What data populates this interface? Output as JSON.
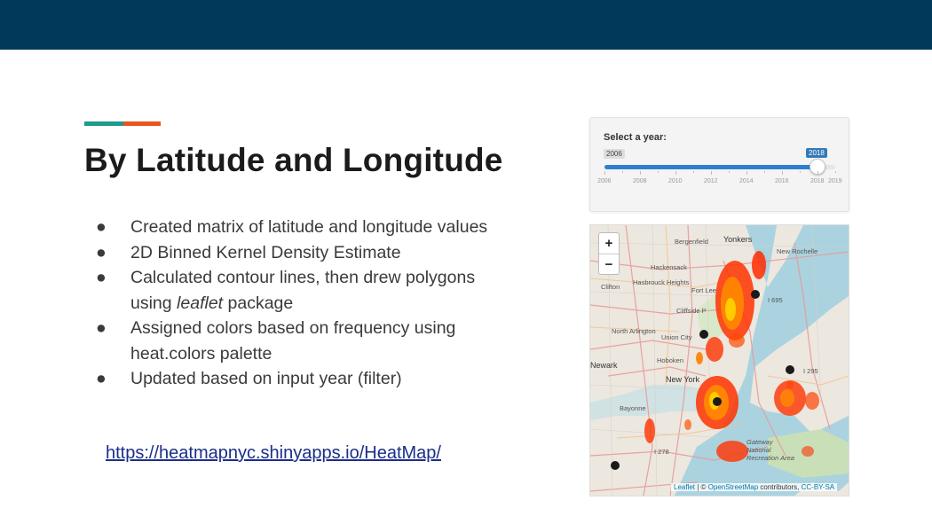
{
  "slide": {
    "title": "By Latitude and Longitude",
    "bullets": [
      {
        "text": "Created matrix of latitude and longitude values"
      },
      {
        "text": "2D Binned Kernel Density Estimate"
      },
      {
        "text_pre": "Calculated contour lines, then drew polygons using ",
        "text_em": "leaflet",
        "text_post": " package"
      },
      {
        "text": "Assigned colors based on frequency using heat.colors palette"
      },
      {
        "text": "Updated based on input year (filter)"
      }
    ],
    "bullet_marker": "●",
    "link": "https://heatmapnyc.shinyapps.io/HeatMap/"
  },
  "slider": {
    "label": "Select a year:",
    "min_label": "2006",
    "value_label": "2018",
    "min": 2006,
    "max": 2019,
    "value": 2018,
    "tick_labels": [
      "2006",
      "2008",
      "2010",
      "2012",
      "2014",
      "2016",
      "2018",
      "2019"
    ]
  },
  "map": {
    "zoom_in": "+",
    "zoom_out": "−",
    "attribution": {
      "leaflet": "Leaflet",
      "sep1": " | © ",
      "osm": "OpenStreetMap",
      "mid": " contributors, ",
      "license": "CC-BY-SA"
    },
    "places": [
      "Yonkers",
      "New Rochelle",
      "Bergenfield",
      "Hackensack",
      "Fort Lee",
      "Cliffside P",
      "Union City",
      "Hoboken",
      "New York",
      "Bayonne",
      "Newark",
      "I 295",
      "I 278",
      "Gateway National Recreation Area",
      "North Arlington",
      "Clifton",
      "Hasbrouck Heights",
      "I 695"
    ]
  },
  "colors": {
    "header": "#003a5b",
    "accent_teal": "#1f9a8e",
    "accent_orange": "#e8561e",
    "link": "#1a2e8a",
    "slider_fill": "#2f7fd1"
  }
}
